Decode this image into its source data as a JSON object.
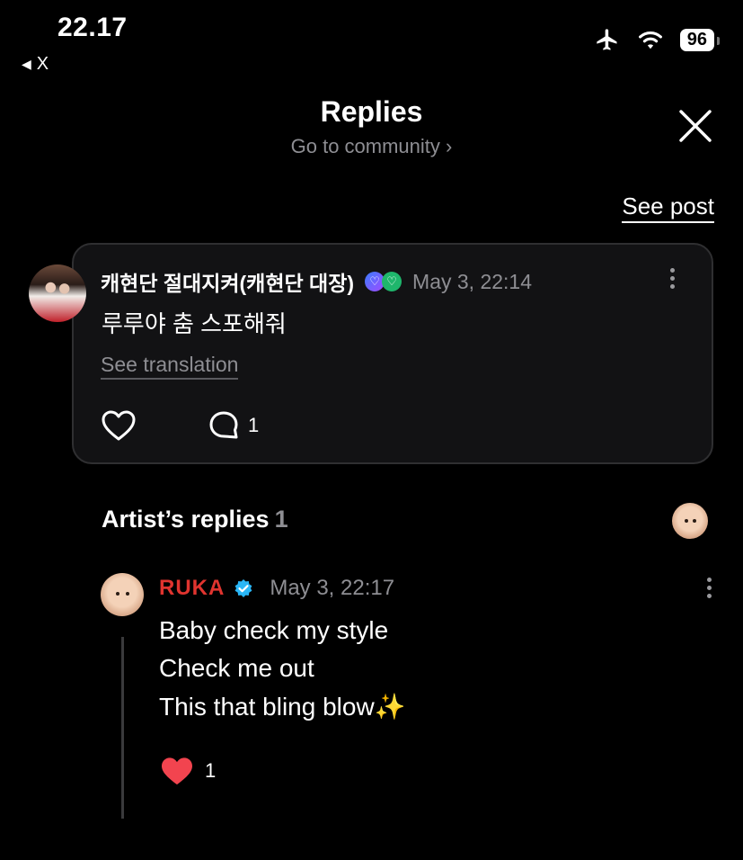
{
  "status_bar": {
    "time": "22.17",
    "back_label": "X",
    "battery": "96"
  },
  "header": {
    "title": "Replies",
    "community_link": "Go to community",
    "see_post": "See post"
  },
  "post": {
    "author": "캐현단 절대지켜(캐현단 대장)",
    "date": "May 3, 22:14",
    "text": "루루야 춤 스포해줘",
    "see_translation": "See translation",
    "comment_count": "1"
  },
  "artist_replies": {
    "heading": "Artist’s replies",
    "count": "1",
    "reply": {
      "author": "RUKA",
      "date": "May 3, 22:17",
      "lines": [
        "Baby check my style",
        "Check me out",
        "This that bling blow✨"
      ],
      "like_count": "1"
    }
  },
  "colors": {
    "background": "#000000",
    "accent_red": "#e0342f",
    "muted": "#8e8e93",
    "verified": "#29b6f6"
  }
}
